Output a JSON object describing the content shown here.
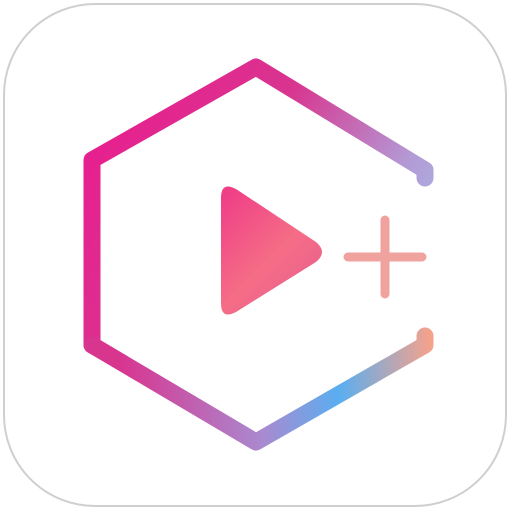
{
  "app_icon": {
    "background": "#ffffff",
    "border_color": "#cfcfcf",
    "glyphs": [
      "hexagon-frame-icon",
      "play-icon",
      "plus-icon"
    ],
    "gradient": {
      "pink": "#e7208f",
      "magenta": "#d8358f",
      "lavender": "#b39bd6",
      "sky": "#9fc9ee",
      "blue": "#5aaef0",
      "coral": "#f56d86",
      "peach": "#f4a28c"
    }
  }
}
